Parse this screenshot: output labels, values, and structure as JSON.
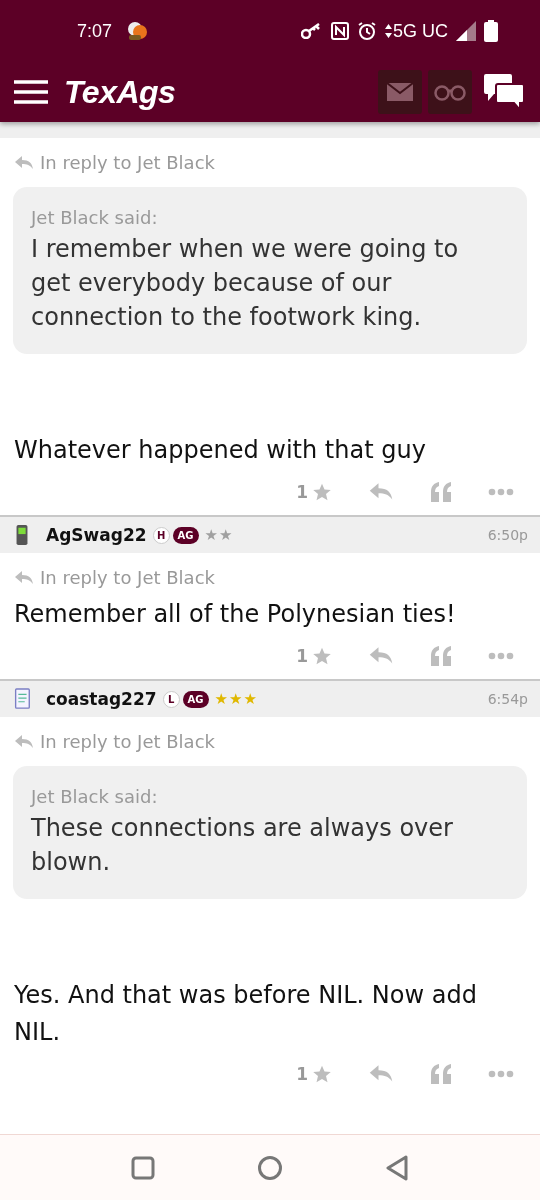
{
  "status_bar": {
    "time": "7:07",
    "network": "5G UC"
  },
  "app_bar": {
    "logo": "TexAgs"
  },
  "posts": [
    {
      "reply_to": "In reply to Jet Black",
      "quote": {
        "author": "Jet Black said:",
        "text": "I remember when we were going to get everybody because of our connection to the footwork king."
      },
      "body": "Whatever happened with that guy",
      "likes": "1"
    },
    {
      "user": "AgSwag22",
      "badges": [
        {
          "text": "H",
          "kind": "circle"
        },
        {
          "text": "AG",
          "kind": "pill"
        }
      ],
      "rank": {
        "text": "★★",
        "color": "#a0a0a0"
      },
      "time": "6:50p",
      "reply_to": "In reply to Jet Black",
      "body": "Remember all of the Polynesian ties!",
      "likes": "1"
    },
    {
      "user": "coastag227",
      "badges": [
        {
          "text": "L",
          "kind": "circle"
        },
        {
          "text": "AG",
          "kind": "pill"
        }
      ],
      "rank": {
        "text": "★★★",
        "color": "#e0b800"
      },
      "time": "6:54p",
      "reply_to": "In reply to Jet Black",
      "quote": {
        "author": "Jet Black said:",
        "text": "These connections are always over blown."
      },
      "body": "Yes. And that was before NIL. Now add NIL.",
      "likes": "1"
    }
  ]
}
